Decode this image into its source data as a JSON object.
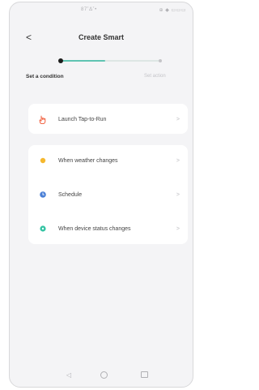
{
  "status_bar": {
    "left": "87˚Δ˚•",
    "right": "⊕ ◆ ▭▭▭"
  },
  "header": {
    "back_glyph": "<",
    "title": "Create Smart"
  },
  "progress": {
    "completed_fraction": 0.45
  },
  "steps": {
    "current": "Set a condition",
    "next": "Set action"
  },
  "conditions_primary": [
    {
      "label": "Launch Tap-to-Run",
      "icon": "tap-hand-icon",
      "color": "#f26a4b"
    }
  ],
  "conditions": [
    {
      "label": "When weather changes",
      "icon": "sun-icon",
      "color": "#f5b82e"
    },
    {
      "label": "Schedule",
      "icon": "clock-icon",
      "color": "#4a7fd6"
    },
    {
      "label": "When device status changes",
      "icon": "device-icon",
      "color": "#34c3a3"
    }
  ],
  "chevron": ">",
  "nav": {
    "back": "◁",
    "home": "home-icon",
    "recent": "recent-apps-icon"
  }
}
